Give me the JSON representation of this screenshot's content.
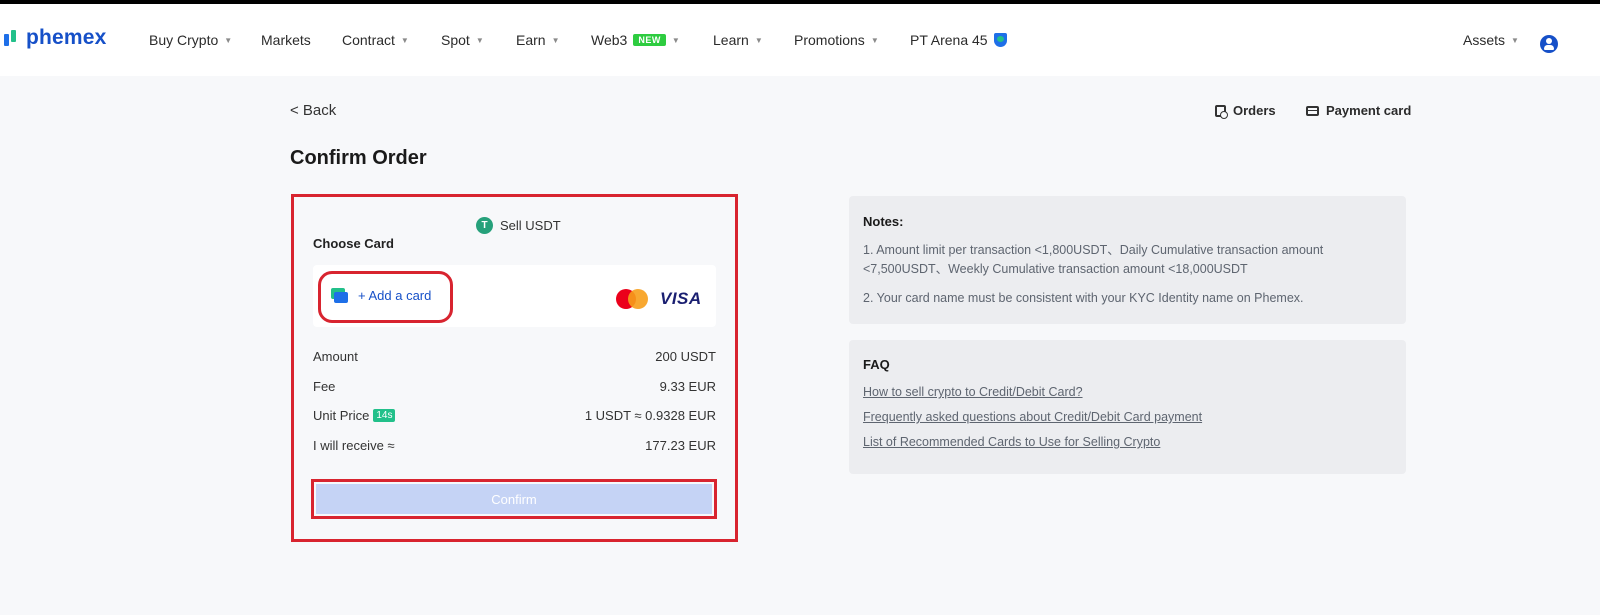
{
  "nav": {
    "logo": "phemex",
    "items": [
      {
        "label": "Buy Crypto",
        "caret": true
      },
      {
        "label": "Markets",
        "caret": false
      },
      {
        "label": "Contract",
        "caret": true
      },
      {
        "label": "Spot",
        "caret": true
      },
      {
        "label": "Earn",
        "caret": true
      },
      {
        "label": "Web3",
        "caret": true,
        "badge": "NEW"
      },
      {
        "label": "Learn",
        "caret": true
      },
      {
        "label": "Promotions",
        "caret": true
      },
      {
        "label": "PT Arena 45",
        "caret": false
      }
    ],
    "assets_label": "Assets"
  },
  "header": {
    "back_label": "< Back",
    "orders_label": "Orders",
    "payment_card_label": "Payment card",
    "page_title": "Confirm Order"
  },
  "order": {
    "sell_label": "Sell USDT",
    "token_symbol": "T",
    "choose_card_label": "Choose Card",
    "add_card_label": "+ Add a card",
    "visa_label": "VISA",
    "rows": [
      {
        "label": "Amount",
        "value": "200 USDT"
      },
      {
        "label": "Fee",
        "value": "9.33 EUR"
      },
      {
        "label": "Unit Price",
        "badge": "14s",
        "value": "1 USDT ≈ 0.9328 EUR"
      },
      {
        "label": "I will receive ≈",
        "value": "177.23 EUR"
      }
    ],
    "confirm_label": "Confirm"
  },
  "notes": {
    "title": "Notes:",
    "line1a": "1. Amount limit per transaction <1,800USDT、Daily Cumulative transaction amount",
    "line1b": "<7,500USDT、Weekly Cumulative transaction amount <18,000USDT",
    "line2": "2. Your card name must be consistent with your KYC Identity name on Phemex."
  },
  "faq": {
    "title": "FAQ",
    "links": [
      "How to sell crypto to Credit/Debit Card?",
      "Frequently asked questions about Credit/Debit Card payment",
      "List of Recommended Cards to Use for Selling Crypto"
    ]
  },
  "colors": {
    "brand": "#1650c8",
    "accent_green": "#22c08a",
    "highlight_red": "#d8242f",
    "confirm_disabled": "#c5d3f5"
  }
}
